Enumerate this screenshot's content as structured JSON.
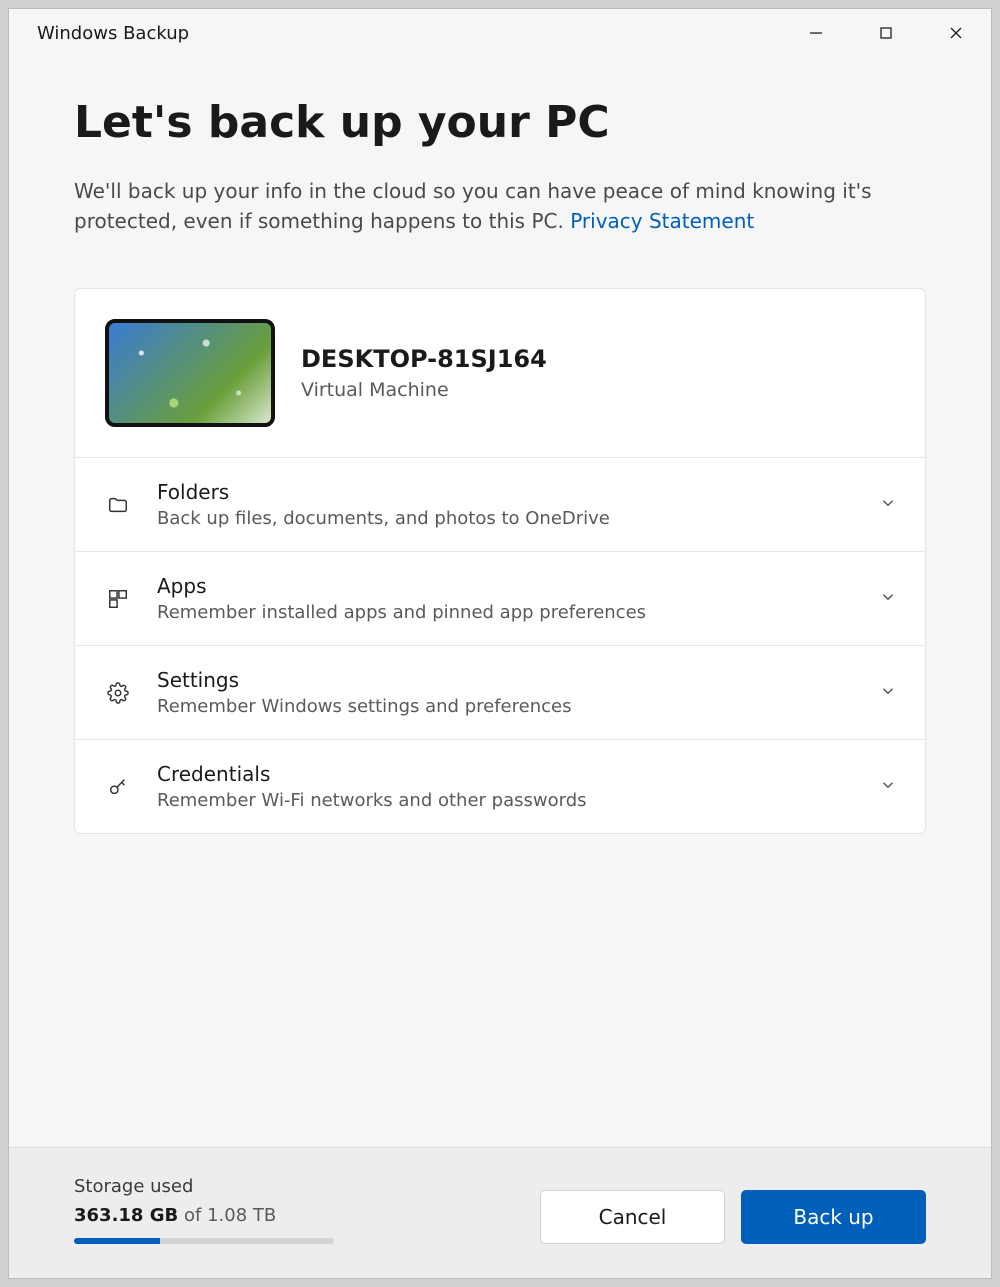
{
  "titlebar": {
    "title": "Windows Backup"
  },
  "page": {
    "heading": "Let's back up your PC",
    "description": "We'll back up your info in the cloud so you can have peace of mind knowing it's protected, even if something happens to this PC.",
    "privacy_link": "Privacy Statement"
  },
  "device": {
    "name": "DESKTOP-81SJ164",
    "type": "Virtual Machine"
  },
  "items": [
    {
      "icon": "folder-icon",
      "title": "Folders",
      "subtitle": "Back up files, documents, and photos to OneDrive"
    },
    {
      "icon": "apps-icon",
      "title": "Apps",
      "subtitle": "Remember installed apps and pinned app preferences"
    },
    {
      "icon": "gear-icon",
      "title": "Settings",
      "subtitle": "Remember Windows settings and preferences"
    },
    {
      "icon": "key-icon",
      "title": "Credentials",
      "subtitle": "Remember Wi-Fi networks and other passwords"
    }
  ],
  "storage": {
    "label": "Storage used",
    "used": "363.18 GB",
    "of_word": "of",
    "total": "1.08 TB",
    "percent": 33
  },
  "buttons": {
    "cancel": "Cancel",
    "backup": "Back up"
  }
}
